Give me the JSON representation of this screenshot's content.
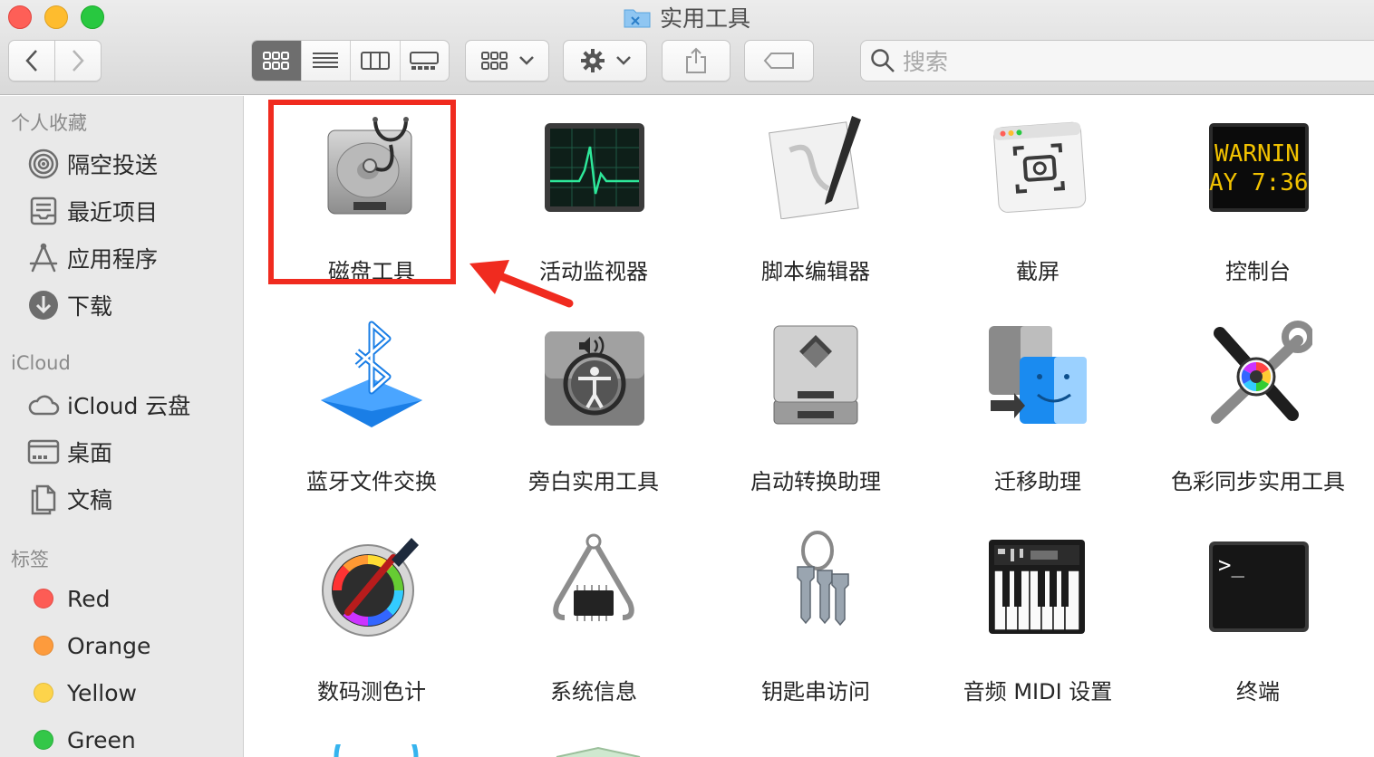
{
  "window": {
    "title": "实用工具"
  },
  "search": {
    "placeholder": "搜索"
  },
  "sidebar": {
    "favorites_header": "个人收藏",
    "favorites": [
      {
        "label": "隔空投送",
        "icon": "airdrop-icon"
      },
      {
        "label": "最近项目",
        "icon": "recents-icon"
      },
      {
        "label": "应用程序",
        "icon": "applications-icon"
      },
      {
        "label": "下载",
        "icon": "downloads-icon"
      }
    ],
    "icloud_header": "iCloud",
    "icloud": [
      {
        "label": "iCloud 云盘",
        "icon": "icloud-drive-icon"
      },
      {
        "label": "桌面",
        "icon": "desktop-icon"
      },
      {
        "label": "文稿",
        "icon": "documents-icon"
      }
    ],
    "tags_header": "标签",
    "tags": [
      {
        "label": "Red",
        "color": "#fd5c55"
      },
      {
        "label": "Orange",
        "color": "#fd9b3d"
      },
      {
        "label": "Yellow",
        "color": "#fdd44b"
      },
      {
        "label": "Green",
        "color": "#33c748"
      }
    ]
  },
  "apps": [
    {
      "label": "磁盘工具",
      "icon": "disk-utility-icon"
    },
    {
      "label": "活动监视器",
      "icon": "activity-monitor-icon"
    },
    {
      "label": "脚本编辑器",
      "icon": "script-editor-icon"
    },
    {
      "label": "截屏",
      "icon": "screenshot-icon"
    },
    {
      "label": "控制台",
      "icon": "console-icon",
      "screen_text": [
        "WARNIN",
        "AY 7:36"
      ]
    },
    {
      "label": "蓝牙文件交换",
      "icon": "bluetooth-file-exchange-icon"
    },
    {
      "label": "旁白实用工具",
      "icon": "voiceover-utility-icon"
    },
    {
      "label": "启动转换助理",
      "icon": "boot-camp-assistant-icon"
    },
    {
      "label": "迁移助理",
      "icon": "migration-assistant-icon"
    },
    {
      "label": "色彩同步实用工具",
      "icon": "colorsync-utility-icon"
    },
    {
      "label": "数码测色计",
      "icon": "digital-color-meter-icon"
    },
    {
      "label": "系统信息",
      "icon": "system-information-icon"
    },
    {
      "label": "钥匙串访问",
      "icon": "keychain-access-icon"
    },
    {
      "label": "音频 MIDI 设置",
      "icon": "audio-midi-setup-icon"
    },
    {
      "label": "终端",
      "icon": "terminal-icon",
      "screen_text": ">_"
    }
  ],
  "colors": {
    "highlight": "#f02b1f",
    "sidebar_bg": "#e9e9e9",
    "accent": "#0a84ff"
  }
}
